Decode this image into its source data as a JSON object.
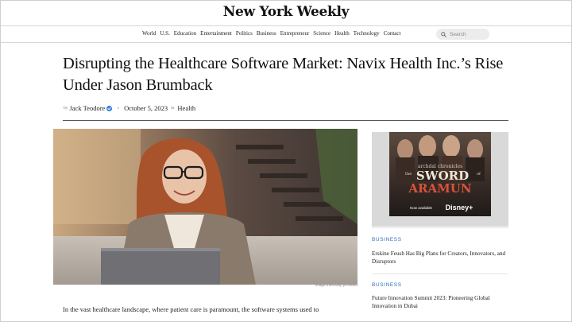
{
  "masthead": {
    "logo": "New York Weekly"
  },
  "nav": {
    "items": [
      "World",
      "U.S.",
      "Education",
      "Entertainment",
      "Politics",
      "Business",
      "Entrepreneur",
      "Science",
      "Health",
      "Technology",
      "Contact"
    ],
    "search_placeholder": "Search"
  },
  "article": {
    "headline": "Disrupting the Healthcare Software Market: Navix Health Inc.’s Rise Under Jason Brumback",
    "by_label": "by",
    "author": "Jack Teodore",
    "date": "October 5, 2023",
    "in_label": "in",
    "category": "Health",
    "image_caption": "Image internally provided",
    "body_first_line": "In the vast healthcare landscape, where patient care is paramount, the software systems used to"
  },
  "sidebar": {
    "ad": {
      "small_title": "archdal chronicles",
      "title_line1": "SWORD",
      "title_prefix": "the",
      "title_suffix": "of",
      "title_line2": "ARAMUN",
      "now_available": "Now available",
      "streaming": "Disney+"
    },
    "cards": [
      {
        "category": "BUSINESS",
        "title": "Erskine Feush Has Big Plans for Creators, Innovators, and Disruptors"
      },
      {
        "category": "BUSINESS",
        "title": "Future Innovation Summit 2023: Pioneering Global Innovation in Dubai"
      }
    ]
  }
}
